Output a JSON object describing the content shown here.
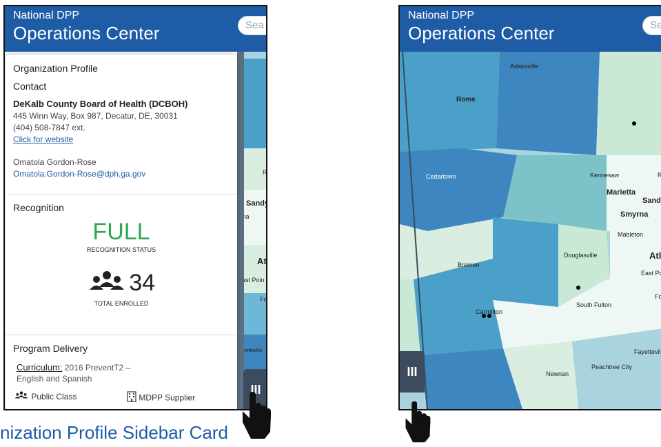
{
  "header": {
    "subtitle": "National DPP",
    "title": "Operations Center",
    "search_placeholder_left": "Sea",
    "search_placeholder_right": "Sea"
  },
  "card": {
    "title": "Organization Profile",
    "contact_label": "Contact",
    "org_name": "DeKalb County Board of Health (DCBOH)",
    "address": "445 Winn Way, Box 987, Decatur, DE, 30031",
    "phone": "(404) 508-7847 ext.",
    "website_link": "Click for website",
    "contact_name": "Omatola Gordon-Rose",
    "contact_email": "Omatola.Gordon-Rose@dph.ga.gov",
    "recognition_label": "Recognition",
    "recognition_value": "FULL",
    "recognition_caption": "RECOGNITION STATUS",
    "enrolled_value": "34",
    "enrolled_caption": "TOTAL ENROLLED",
    "delivery_label": "Program Delivery",
    "curriculum_label": "Curriculum:",
    "curriculum_value": "2016 PreventT2 –",
    "curriculum_value2": "English and Spanish",
    "class_type": "Public Class",
    "supplier_type": "MDPP Supplier"
  },
  "toggle_label": "III",
  "caption": "nization Profile Sidebar Card",
  "map_left_labels": [
    "R",
    "Sandy",
    "ma",
    "Atl",
    "ast Poin",
    "For",
    "yetteville"
  ],
  "map_right_labels": [
    "Adairsville",
    "Rome",
    "Cedartown",
    "Kennesaw",
    "R",
    "Marietta",
    "Sandy",
    "Smyrna",
    "Mableton",
    "Douglasville",
    "Atl",
    "Bremen",
    "East Poi",
    "South Fulton",
    "For",
    "Carrollton",
    "Fayetteville",
    "Peachtree City",
    "Newnan"
  ],
  "colors": {
    "header": "#1f5ca6",
    "recognition": "#2fa84f"
  }
}
